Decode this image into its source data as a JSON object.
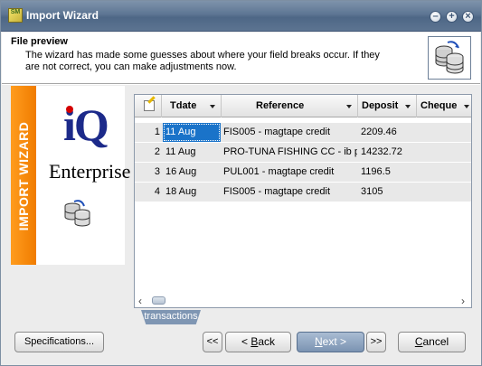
{
  "window": {
    "title": "Import Wizard",
    "app_icon_text": "SM"
  },
  "header": {
    "heading": "File preview",
    "description": "The wizard has made some guesses about where your field breaks occur. If they are not correct, you can make adjustments now."
  },
  "sidebar": {
    "band_text": "IMPORT WIZARD",
    "logo_iq": "iQ",
    "logo_enterprise": "Enterprise"
  },
  "grid": {
    "columns": [
      "Tdate",
      "Reference",
      "Deposit",
      "Cheque"
    ],
    "rows": [
      {
        "n": "1",
        "tdate": "11 Aug",
        "reference": "FIS005  - magtape credit",
        "deposit": "2209.46",
        "cheque": ""
      },
      {
        "n": "2",
        "tdate": "11 Aug",
        "reference": "PRO-TUNA FISHING CC  - ib pa",
        "deposit": "14232.72",
        "cheque": ""
      },
      {
        "n": "3",
        "tdate": "16 Aug",
        "reference": "PUL001  - magtape credit",
        "deposit": "1196.5",
        "cheque": ""
      },
      {
        "n": "4",
        "tdate": "18 Aug",
        "reference": "FIS005  - magtape credit",
        "deposit": "3105",
        "cheque": ""
      }
    ],
    "selected_row": 1,
    "sheet_tab": "transactions"
  },
  "footer": {
    "specifications": "Specifications...",
    "first": "<<",
    "back_prefix": "< ",
    "back_key": "B",
    "back_rest": "ack",
    "next_key": "N",
    "next_rest": "ext >",
    "last": ">>",
    "cancel_key": "C",
    "cancel_rest": "ancel"
  },
  "colors": {
    "title_bar": "#5d7593",
    "orange_band": "#f07c00",
    "selection": "#1a73c9",
    "primary_button": "#7b93b2"
  }
}
